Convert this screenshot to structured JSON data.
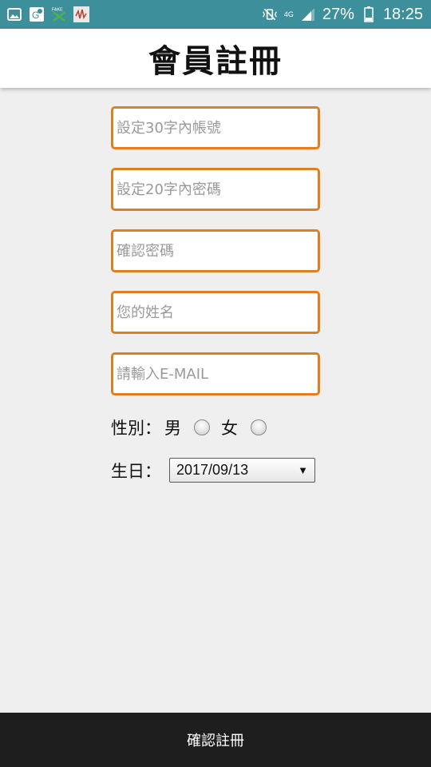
{
  "status_bar": {
    "network": "4G",
    "battery_percent": "27%",
    "time": "18:25",
    "notification_icons": [
      "gallery-icon",
      "maps-icon",
      "fake-gps-icon",
      "app-icon"
    ]
  },
  "header": {
    "title": "會員註冊"
  },
  "form": {
    "account_placeholder": "設定30字內帳號",
    "password_placeholder": "設定20字內密碼",
    "confirm_password_placeholder": "確認密碼",
    "name_placeholder": "您的姓名",
    "email_placeholder": "請輸入E-MAIL",
    "gender_label": "性別：",
    "gender_male": "男",
    "gender_female": "女",
    "birthday_label": "生日：",
    "birthday_value": "2017/09/13"
  },
  "submit": {
    "label": "確認註冊"
  },
  "colors": {
    "status_bar": "#3e8f9c",
    "field_border": "#e07e22",
    "submit_bar": "#1e1e1e",
    "background": "#efefef"
  }
}
